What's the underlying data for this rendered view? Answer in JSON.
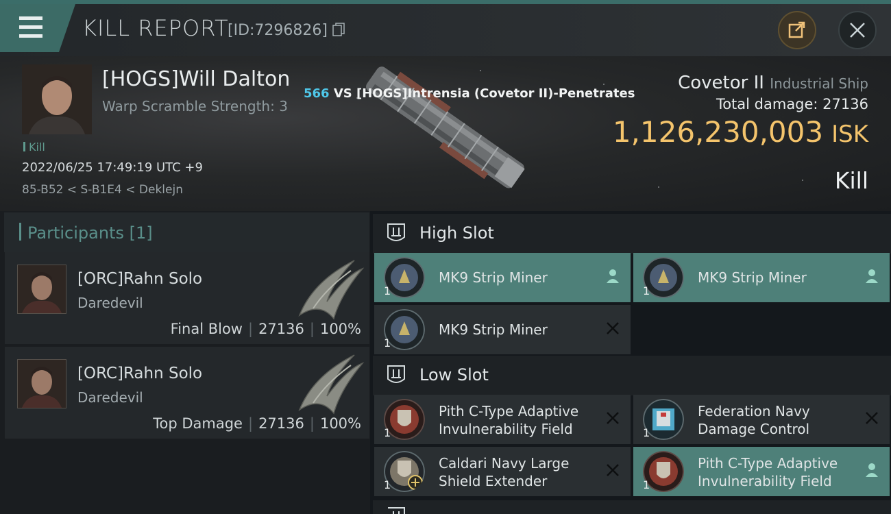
{
  "header": {
    "title": "KILL REPORT",
    "report_id": "[ID:7296826]"
  },
  "victim": {
    "name": "[HOGS]Will Dalton",
    "warp_scramble": "Warp Scramble Strength: 3",
    "kill_tag": "Kill",
    "datetime": "2022/06/25 17:49:19 UTC +9",
    "location": "85-B52 < S-B1E4 < Deklejn"
  },
  "versus": {
    "number": "566",
    "text": " VS [HOGS]Intrensia (Covetor II)-Penetrates"
  },
  "ship": {
    "name": "Covetor II",
    "class": "Industrial Ship",
    "total_damage": "Total damage:  27136",
    "isk_value": "1,126,230,003",
    "isk_unit": "ISK",
    "result": "Kill"
  },
  "participants": {
    "title": "Participants [1]",
    "items": [
      {
        "name": "[ORC]Rahn Solo",
        "ship": "Daredevil",
        "label": "Final Blow",
        "damage": "27136",
        "percent": "100%"
      },
      {
        "name": "[ORC]Rahn Solo",
        "ship": "Daredevil",
        "label": "Top Damage",
        "damage": "27136",
        "percent": "100%"
      }
    ]
  },
  "slots": {
    "high": {
      "title": "High Slot",
      "modules": [
        {
          "name": "MK9 Strip Miner",
          "qty": "1",
          "state": "dropped"
        },
        {
          "name": "MK9 Strip Miner",
          "qty": "1",
          "state": "dropped"
        },
        {
          "name": "MK9 Strip Miner",
          "qty": "1",
          "state": "destroyed"
        }
      ]
    },
    "low": {
      "title": "Low Slot",
      "modules": [
        {
          "line1": "Pith C-Type Adaptive",
          "line2": "Invulnerability Field",
          "qty": "1",
          "state": "destroyed"
        },
        {
          "line1": "Federation Navy",
          "line2": "Damage Control",
          "qty": "1",
          "state": "destroyed"
        },
        {
          "line1": "Caldari Navy Large",
          "line2": "Shield Extender",
          "qty": "1",
          "state": "destroyed"
        },
        {
          "line1": "Pith C-Type Adaptive",
          "line2": "Invulnerability Field",
          "qty": "1",
          "state": "dropped"
        }
      ]
    }
  },
  "colors": {
    "accent_teal": "#4e8079",
    "isk_gold": "#f4c46c",
    "vs_blue": "#4fc8ea"
  }
}
